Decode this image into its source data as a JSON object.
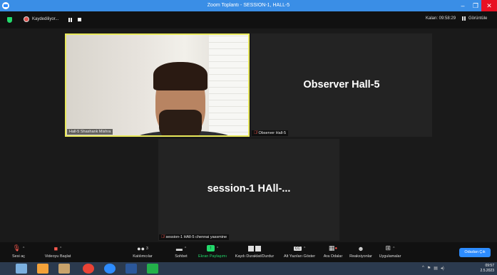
{
  "window": {
    "title": "Zoom Toplantı - SESSION-1, HALL-5",
    "minimize": "–",
    "maximize": "❐",
    "close": "✕"
  },
  "topbar": {
    "recording_label": "Kaydediliyor...",
    "timer": "Kalan: 09:58:29",
    "view_label": "Görüntüle"
  },
  "participants": [
    {
      "name": "Hall-5 Shashank Mishra",
      "muted": true,
      "active_speaker": true
    },
    {
      "name": "Observer Hall-5",
      "display_name": "Observer Hall-5",
      "muted": true
    },
    {
      "name": "session-1  HAll-5 chennai yassmine",
      "display_name": "session-1   HAll-...",
      "muted": true
    }
  ],
  "toolbar": {
    "items": [
      {
        "label": "Sesi aç",
        "icon": "mic-muted-icon"
      },
      {
        "label": "Videoyu Başlat",
        "icon": "video-off-icon"
      },
      {
        "label": "Katılımcılar",
        "icon": "participants-icon",
        "count": "3"
      },
      {
        "label": "Sohbet",
        "icon": "chat-icon"
      },
      {
        "label": "Ekran Paylaşımı",
        "icon": "share-screen-icon",
        "color": "#23d96b"
      },
      {
        "label": "Kaydı Duraklat/Durdur",
        "icon": "pause-stop-icon"
      },
      {
        "label": "Alt Yazıları Göster",
        "icon": "cc-icon"
      },
      {
        "label": "Ara Odalar",
        "icon": "breakout-rooms-icon"
      },
      {
        "label": "Reaksiyonlar",
        "icon": "reactions-icon"
      },
      {
        "label": "Uygulamalar",
        "icon": "apps-icon"
      }
    ],
    "end_label": "Odadan Çık"
  },
  "taskbar": {
    "time": "09:57",
    "date": "2.5.2023"
  },
  "colors": {
    "accent": "#2d8cff",
    "active_border": "#e8e85a",
    "muted_red": "#ff5a4f",
    "share_green": "#23d96b"
  }
}
